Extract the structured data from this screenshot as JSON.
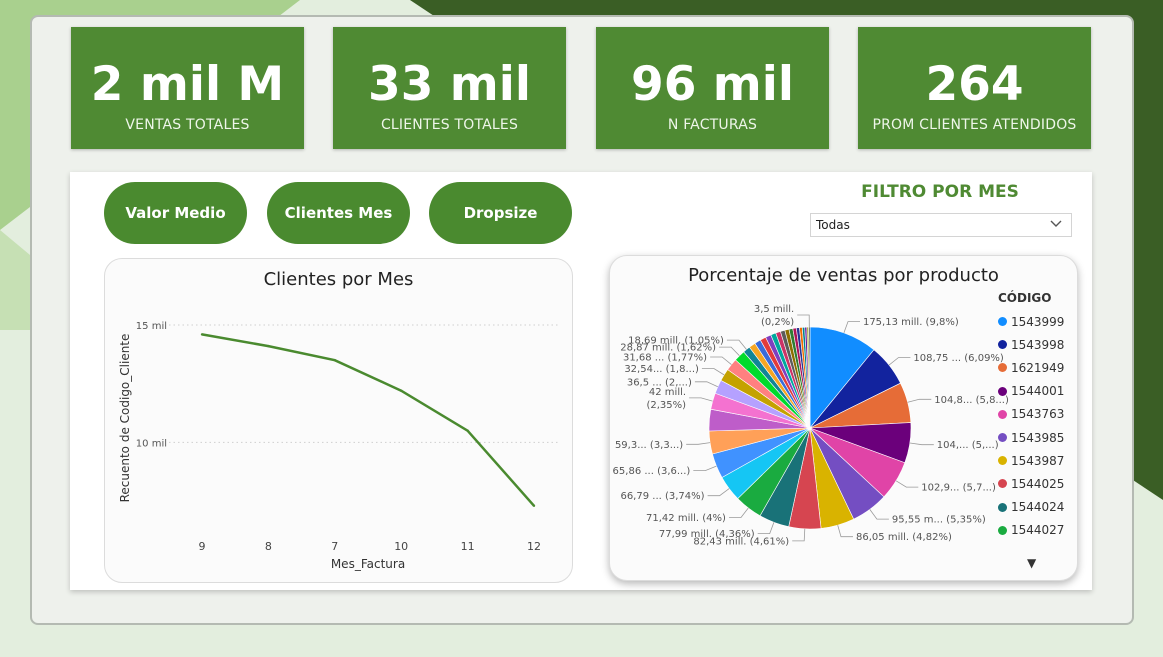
{
  "kpis": [
    {
      "value": "2 mil M",
      "label": "VENTAS TOTALES"
    },
    {
      "value": "33 mil",
      "label": "CLIENTES TOTALES"
    },
    {
      "value": "96 mil",
      "label": "N FACTURAS"
    },
    {
      "value": "264",
      "label": "PROM CLIENTES ATENDIDOS"
    }
  ],
  "buttons": {
    "valor_medio": "Valor Medio",
    "clientes_mes": "Clientes Mes",
    "dropsize": "Dropsize"
  },
  "filter": {
    "title": "FILTRO POR MES",
    "selected": "Todas"
  },
  "line_chart": {
    "title": "Clientes por Mes"
  },
  "pie_chart": {
    "title": "Porcentaje de ventas por producto",
    "legend_title": "CÓDIGO"
  },
  "colors": {
    "brand_green": "#4f8a33",
    "dark_green": "#385f22"
  },
  "chart_data": [
    {
      "type": "line",
      "title": "Clientes por Mes",
      "xlabel": "Mes_Factura",
      "ylabel": "Recuento de Codigo_Cliente",
      "categories": [
        "9",
        "8",
        "7",
        "10",
        "11",
        "12"
      ],
      "values": [
        14600,
        14100,
        13500,
        12200,
        10500,
        7300
      ],
      "yticks": [
        "10 mil",
        "15 mil"
      ],
      "ylim": [
        7000,
        15000
      ],
      "color": "#4a8a2f",
      "grid": true
    },
    {
      "type": "pie",
      "title": "Porcentaje de ventas por producto",
      "legend": [
        "1543999",
        "1543998",
        "1621949",
        "1544001",
        "1543763",
        "1543985",
        "1543987",
        "1544025",
        "1544024",
        "1544027"
      ],
      "values": [
        9.8,
        6.09,
        5.8,
        5.8,
        5.7,
        5.35,
        4.82,
        4.61,
        4.36,
        4.0,
        3.74,
        3.6,
        3.3,
        3.1,
        2.35,
        2.0,
        1.8,
        1.77,
        1.62,
        1.05,
        0.95,
        0.9,
        0.85,
        0.8,
        0.75,
        0.7,
        0.65,
        0.6,
        0.55,
        0.5,
        0.45,
        0.4,
        0.35,
        0.3,
        0.25,
        0.2
      ],
      "colors": [
        "#118dff",
        "#12239e",
        "#e66c37",
        "#6b007b",
        "#e044a7",
        "#744ec2",
        "#d9b300",
        "#d64550",
        "#197278",
        "#1aab40",
        "#15c6f4",
        "#4092ff",
        "#ffa058",
        "#be5dc9",
        "#f472d0",
        "#b5a1ff",
        "#c4a200",
        "#ff8080",
        "#00db2c",
        "#108597",
        "#f5a623",
        "#3a6bd9",
        "#e23b3b",
        "#7f3fbf",
        "#00a89d",
        "#cc3366",
        "#5c5c5c",
        "#8d6e00",
        "#2e7d32",
        "#ad1457",
        "#283593",
        "#ef6c00",
        "#00838f",
        "#6a1b9a",
        "#9e9d24",
        "#37474f"
      ],
      "labels": [
        {
          "text": "175,13 mill. (9,8%)",
          "slice": 0
        },
        {
          "text": "108,75 ... (6,09%)",
          "slice": 1
        },
        {
          "text": "104,8... (5,8...)",
          "slice": 2
        },
        {
          "text": "104,... (5,...)",
          "slice": 3
        },
        {
          "text": "102,9... (5,7...)",
          "slice": 4
        },
        {
          "text": "95,55 m... (5,35%)",
          "slice": 5
        },
        {
          "text": "86,05 mill. (4,82%)",
          "slice": 6
        },
        {
          "text": "82,43 mill. (4,61%)",
          "slice": 7
        },
        {
          "text": "77,99 mill. (4,36%)",
          "slice": 8
        },
        {
          "text": "71,42 mill. (4%)",
          "slice": 9
        },
        {
          "text": "66,79 ... (3,74%)",
          "slice": 10
        },
        {
          "text": "65,86 ... (3,6...)",
          "slice": 11
        },
        {
          "text": "59,3... (3,3...)",
          "slice": 12
        },
        {
          "text": "42 mill.",
          "text2": "(2,35%)",
          "slice": 14
        },
        {
          "text": "36,5 ... (2,...)",
          "slice": 15
        },
        {
          "text": "32,54... (1,8...)",
          "slice": 16
        },
        {
          "text": "31,68 ... (1,77%)",
          "slice": 17
        },
        {
          "text": "28,87 mill. (1,62%)",
          "slice": 18
        },
        {
          "text": "18,69 mill. (1,05%)",
          "slice": 19
        },
        {
          "text": "3,5 mill.",
          "text2": "(0,2%)",
          "slice": 35
        }
      ]
    }
  ]
}
